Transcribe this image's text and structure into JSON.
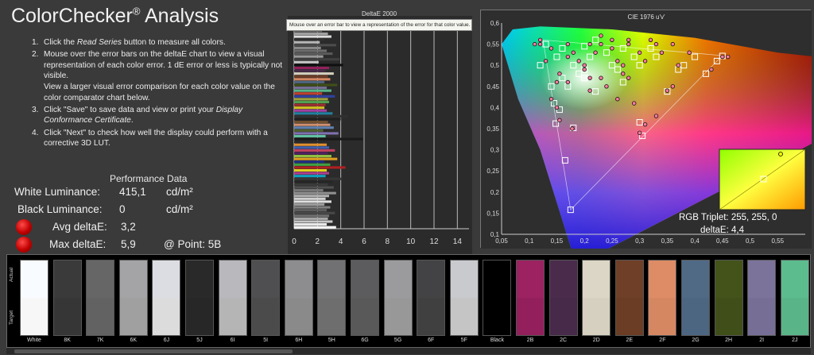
{
  "app": {
    "title": "ColorChecker",
    "reg": "®",
    "title_suffix": " Analysis"
  },
  "tooltip": "Mouse over an error bar to view a representation of the error for that color value. 1 dE error or less is typically not visible.",
  "instructions": {
    "s1_num": "1.",
    "s1_a": "Click the ",
    "s1_b": "Read Series",
    "s1_c": " button to measure all colors.",
    "s2_num": "2.",
    "s2": "Mouse over the error bars on the deltaE chart to view a visual representation of each color error. 1 dE error or less is typically not visible.",
    "s2_extra": "View a larger visual error comparison for each color value on the color comparator chart below.",
    "s3_num": "3.",
    "s3_a": "Click \"Save\" to save data and view or print your ",
    "s3_b": "Display Conformance Certificate",
    "s3_c": ".",
    "s4_num": "4.",
    "s4": "Click \"Next\" to check how well the display could perform with a corrective 3D LUT."
  },
  "performance": {
    "title": "Performance Data",
    "white_label": "White Luminance:",
    "white_value": "415,1",
    "white_unit": "cd/m²",
    "black_label": "Black Luminance:",
    "black_value": "0",
    "black_unit": "cd/m²",
    "avg_label": "Avg deltaE:",
    "avg_value": "3,2",
    "max_label": "Max deltaE:",
    "max_value": "5,9",
    "point_label": "@ Point: 5B",
    "indicator_color": "#d00000"
  },
  "deltaE_chart": {
    "title": "DeltaE 2000",
    "x_ticks": [
      "0",
      "2",
      "4",
      "6",
      "8",
      "10",
      "12",
      "14"
    ],
    "xlim": [
      0,
      15
    ],
    "grid_lines": [
      2,
      4,
      6,
      8,
      10,
      12,
      14
    ]
  },
  "chart_data": {
    "type": "scatter",
    "title": "CIE 1976 u'v'",
    "xlim": [
      0.05,
      0.6
    ],
    "ylim": [
      0.1,
      0.6
    ],
    "x_ticks": [
      "0,05",
      "0,1",
      "0,15",
      "0,2",
      "0,25",
      "0,3",
      "0,35",
      "0,4",
      "0,45",
      "0,5",
      "0,55"
    ],
    "y_ticks": [
      "0,1",
      "0,15",
      "0,2",
      "0,25",
      "0,3",
      "0,35",
      "0,4",
      "0,45",
      "0,5",
      "0,55",
      "0,6"
    ],
    "targets": [
      [
        0.175,
        0.158
      ],
      [
        0.165,
        0.275
      ],
      [
        0.18,
        0.352
      ],
      [
        0.148,
        0.362
      ],
      [
        0.3,
        0.365
      ],
      [
        0.305,
        0.333
      ],
      [
        0.35,
        0.438
      ],
      [
        0.45,
        0.522
      ],
      [
        0.155,
        0.395
      ],
      [
        0.145,
        0.41
      ],
      [
        0.17,
        0.45
      ],
      [
        0.22,
        0.438
      ],
      [
        0.27,
        0.46
      ],
      [
        0.16,
        0.47
      ],
      [
        0.19,
        0.48
      ],
      [
        0.25,
        0.5
      ],
      [
        0.3,
        0.5
      ],
      [
        0.38,
        0.5
      ],
      [
        0.42,
        0.48
      ],
      [
        0.18,
        0.5
      ],
      [
        0.21,
        0.52
      ],
      [
        0.24,
        0.53
      ],
      [
        0.27,
        0.54
      ],
      [
        0.33,
        0.52
      ],
      [
        0.4,
        0.52
      ],
      [
        0.44,
        0.51
      ],
      [
        0.13,
        0.55
      ],
      [
        0.16,
        0.54
      ],
      [
        0.2,
        0.545
      ],
      [
        0.32,
        0.54
      ],
      [
        0.22,
        0.56
      ],
      [
        0.37,
        0.49
      ],
      [
        0.29,
        0.52
      ],
      [
        0.2,
        0.49
      ],
      [
        0.15,
        0.52
      ],
      [
        0.12,
        0.5
      ],
      [
        0.14,
        0.45
      ],
      [
        0.26,
        0.49
      ],
      [
        0.2,
        0.47
      ]
    ],
    "measured": [
      [
        0.155,
        0.37
      ],
      [
        0.178,
        0.35
      ],
      [
        0.3,
        0.34
      ],
      [
        0.31,
        0.36
      ],
      [
        0.35,
        0.44
      ],
      [
        0.36,
        0.45
      ],
      [
        0.46,
        0.52
      ],
      [
        0.15,
        0.4
      ],
      [
        0.14,
        0.42
      ],
      [
        0.17,
        0.46
      ],
      [
        0.21,
        0.44
      ],
      [
        0.28,
        0.47
      ],
      [
        0.155,
        0.48
      ],
      [
        0.2,
        0.49
      ],
      [
        0.26,
        0.51
      ],
      [
        0.31,
        0.51
      ],
      [
        0.37,
        0.5
      ],
      [
        0.43,
        0.49
      ],
      [
        0.19,
        0.51
      ],
      [
        0.22,
        0.53
      ],
      [
        0.25,
        0.54
      ],
      [
        0.28,
        0.55
      ],
      [
        0.34,
        0.53
      ],
      [
        0.39,
        0.53
      ],
      [
        0.45,
        0.52
      ],
      [
        0.12,
        0.55
      ],
      [
        0.17,
        0.55
      ],
      [
        0.21,
        0.55
      ],
      [
        0.33,
        0.55
      ],
      [
        0.23,
        0.57
      ],
      [
        0.3,
        0.53
      ],
      [
        0.25,
        0.56
      ],
      [
        0.27,
        0.5
      ],
      [
        0.2,
        0.5
      ],
      [
        0.17,
        0.52
      ],
      [
        0.13,
        0.51
      ],
      [
        0.15,
        0.46
      ],
      [
        0.27,
        0.48
      ],
      [
        0.21,
        0.47
      ],
      [
        0.12,
        0.56
      ],
      [
        0.11,
        0.55
      ],
      [
        0.23,
        0.55
      ],
      [
        0.28,
        0.56
      ],
      [
        0.32,
        0.56
      ],
      [
        0.36,
        0.55
      ],
      [
        0.24,
        0.45
      ],
      [
        0.26,
        0.42
      ],
      [
        0.29,
        0.41
      ],
      [
        0.33,
        0.38
      ],
      [
        0.23,
        0.47
      ],
      [
        0.18,
        0.53
      ],
      [
        0.14,
        0.54
      ]
    ],
    "inset": {
      "rgb_label": "RGB Triplet: 255, 255, 0",
      "de_label": "deltaE: 4,4"
    }
  },
  "swatches": {
    "actual_label": "Actual",
    "target_label": "Target",
    "items": [
      {
        "name": "White",
        "actual": "#f8fbff",
        "target": "#f7f7f7"
      },
      {
        "name": "8K",
        "actual": "#3a3a3b",
        "target": "#363636"
      },
      {
        "name": "7K",
        "actual": "#666667",
        "target": "#626262"
      },
      {
        "name": "6K",
        "actual": "#a4a4a6",
        "target": "#a0a0a0"
      },
      {
        "name": "6J",
        "actual": "#dcdde2",
        "target": "#dcdcdc"
      },
      {
        "name": "5J",
        "actual": "#29292a",
        "target": "#272727"
      },
      {
        "name": "6I",
        "actual": "#b9b9bd",
        "target": "#b5b5b5"
      },
      {
        "name": "5I",
        "actual": "#4f4f51",
        "target": "#4b4b4b"
      },
      {
        "name": "6H",
        "actual": "#8d8d90",
        "target": "#8a8a8a"
      },
      {
        "name": "5H",
        "actual": "#717173",
        "target": "#6e6e6e"
      },
      {
        "name": "6G",
        "actual": "#5c5c5e",
        "target": "#595959"
      },
      {
        "name": "5G",
        "actual": "#9b9b9e",
        "target": "#989898"
      },
      {
        "name": "6F",
        "actual": "#434345",
        "target": "#404040"
      },
      {
        "name": "5F",
        "actual": "#c9cace",
        "target": "#c5c5c5"
      },
      {
        "name": "Black",
        "actual": "#000000",
        "target": "#000000"
      },
      {
        "name": "2B",
        "actual": "#9c2262",
        "target": "#93205c"
      },
      {
        "name": "2C",
        "actual": "#4a2b4c",
        "target": "#47294a"
      },
      {
        "name": "2D",
        "actual": "#dbd6c5",
        "target": "#d5d0bf"
      },
      {
        "name": "2E",
        "actual": "#6f3f27",
        "target": "#6b3d25"
      },
      {
        "name": "2F",
        "actual": "#dd8c66",
        "target": "#d58762"
      },
      {
        "name": "2G",
        "actual": "#506a86",
        "target": "#4c6580"
      },
      {
        "name": "2H",
        "actual": "#43531a",
        "target": "#404f19"
      },
      {
        "name": "2I",
        "actual": "#7c739b",
        "target": "#776e95"
      },
      {
        "name": "2J",
        "actual": "#5dbc8e",
        "target": "#59b488"
      }
    ]
  }
}
